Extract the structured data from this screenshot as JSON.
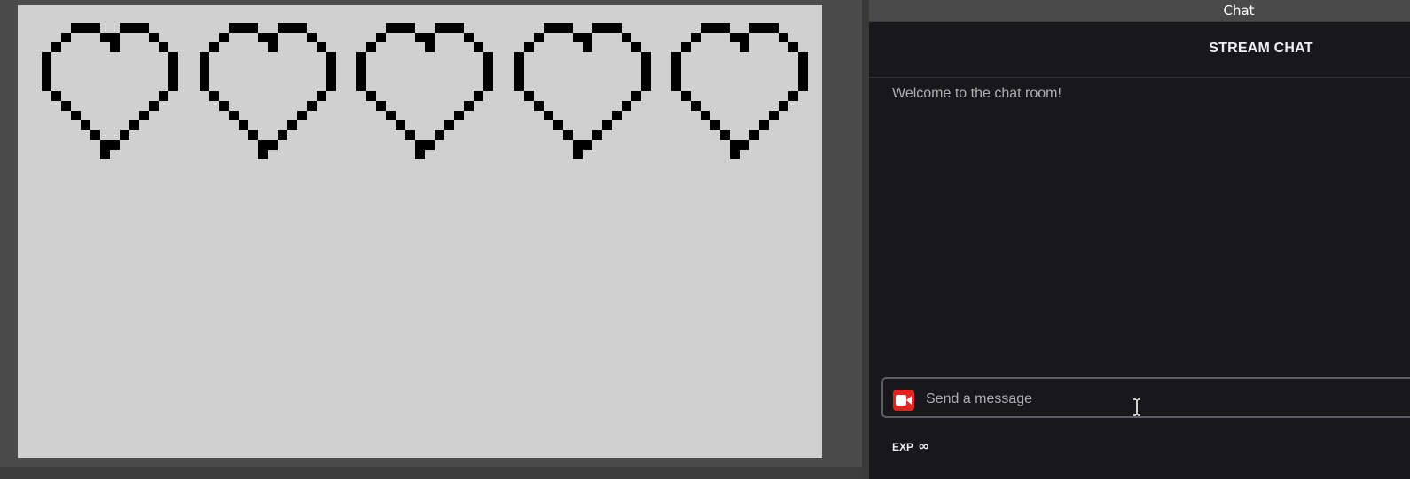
{
  "dock": {
    "title": "Chat"
  },
  "chat": {
    "header": "STREAM CHAT",
    "messages": [
      "Welcome to the chat room!"
    ],
    "input_placeholder": "Send a message",
    "exp_label": "EXP",
    "exp_value": "∞"
  },
  "preview": {
    "heart_count": 5,
    "icon": "pixel-heart-icon"
  },
  "colors": {
    "canvas_bg": "#d0d0d0",
    "pixel": "#000000",
    "chat_bg": "#18181b",
    "accent_red": "#e32424",
    "text_muted": "#adadb8",
    "text_light": "#efeff1"
  }
}
